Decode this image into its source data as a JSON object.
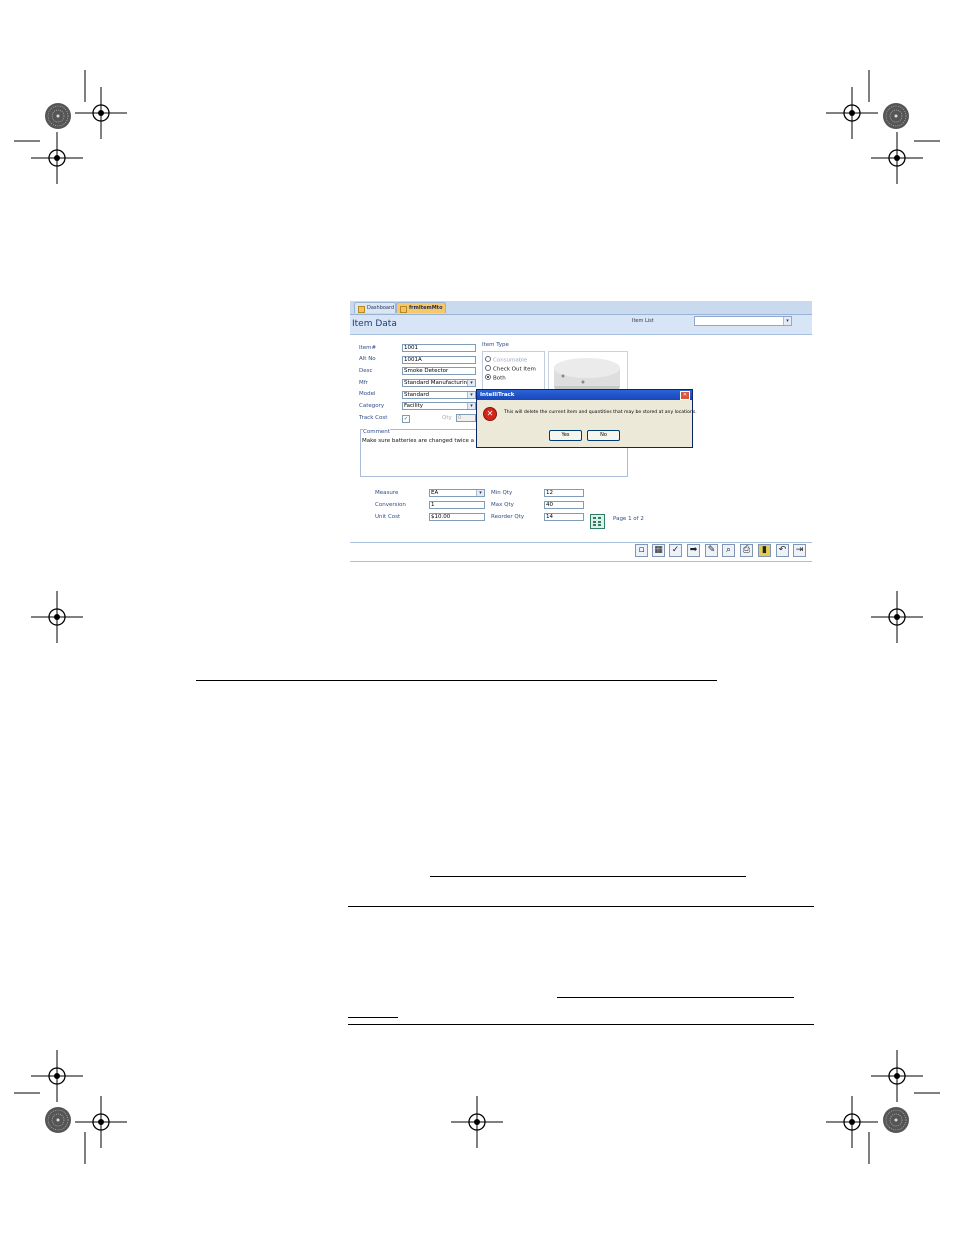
{
  "window": {
    "tabs": [
      {
        "label": "Dashboard"
      },
      {
        "label": "frmItemMto"
      }
    ],
    "title": "Item Data",
    "item_list_label": "Item List",
    "item_list_value": ""
  },
  "form": {
    "item_no_label": "Item#",
    "item_no_value": "1001",
    "alt_no_label": "Alt No",
    "alt_no_value": "1001A",
    "desc_label": "Desc",
    "desc_value": "Smoke Detector",
    "mfr_label": "Mfr",
    "mfr_value": "Standard Manufacturin",
    "model_label": "Model",
    "model_value": "Standard",
    "category_label": "Category",
    "category_value": "Facility",
    "track_cost_label": "Track Cost",
    "qty_label": "Qty",
    "qty_value": "0",
    "comment_label": "Comment",
    "comment_value": "Make sure batteries are changed twice a",
    "item_type_label": "Item Type",
    "item_type_options": [
      "Consumable",
      "Check Out Item",
      "Both"
    ],
    "measure_label": "Measure",
    "measure_value": "EA",
    "conversion_label": "Conversion",
    "conversion_value": "1",
    "unit_cost_label": "Unit Cost",
    "unit_cost_value": "$10.00",
    "min_qty_label": "Min Qty",
    "min_qty_value": "12",
    "max_qty_label": "Max Qty",
    "max_qty_value": "40",
    "reorder_qty_label": "Reorder Qty",
    "reorder_qty_value": "14",
    "page_label": "Page 1 of 2"
  },
  "dialog": {
    "title": "IntelliTrack",
    "close_glyph": "✕",
    "message": "This will delete the current item and quantities that may be stored at any locations.",
    "yes_label": "Yes",
    "no_label": "No"
  },
  "colors": {
    "accent": "#d7e5f7",
    "tab_active": "#f7c86a",
    "dialog_titlebar": "#1f55c9",
    "error_icon": "#d2261a"
  }
}
